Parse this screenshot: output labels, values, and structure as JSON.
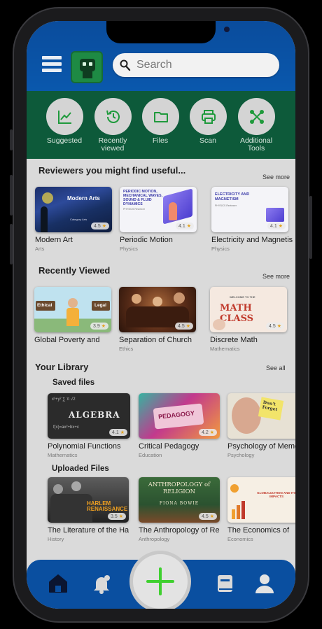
{
  "search": {
    "placeholder": "Search"
  },
  "tools": [
    {
      "label": "Suggested",
      "icon": "chart-icon"
    },
    {
      "label": "Recently viewed",
      "icon": "history-icon"
    },
    {
      "label": "Files",
      "icon": "folder-icon"
    },
    {
      "label": "Scan",
      "icon": "printer-icon"
    },
    {
      "label": "Additional Tools",
      "icon": "nodes-icon"
    }
  ],
  "reviewers": {
    "title": "Reviewers you might find useful...",
    "more": "See more",
    "cards": [
      {
        "name": "Modern Art",
        "category": "Arts",
        "rating": "4.5",
        "thumb_title": "Modern Arts",
        "thumb_sub": "Category Arts"
      },
      {
        "name": "Periodic Motion",
        "category": "Physics",
        "rating": "4.1",
        "thumb_title": "PERIODIC MOTION, MECHANICAL WAVES, SOUND & FLUID DYNAMICS",
        "thumb_sub": "PHYSICS Reviewer"
      },
      {
        "name": "Electricity and Magnetism",
        "category": "Physics",
        "rating": "4.1",
        "thumb_title": "ELECTRICITY AND MAGNETISM",
        "thumb_sub": "PHYSICS Reviewer"
      }
    ]
  },
  "recent": {
    "title": "Recently Viewed",
    "more": "See more",
    "cards": [
      {
        "name": "Global Poverty and",
        "category": "",
        "rating": "3.9",
        "sign_left": "Ethical",
        "sign_right": "Legal"
      },
      {
        "name": "Separation of Church",
        "category": "Ethics",
        "rating": "4.5"
      },
      {
        "name": "Discrete Math",
        "category": "Mathematics",
        "rating": "4.5",
        "thumb_top": "WELCOME TO THE",
        "thumb_title": "MATH CLASS"
      }
    ]
  },
  "library": {
    "title": "Your Library",
    "more": "See all",
    "saved": {
      "title": "Saved files",
      "cards": [
        {
          "name": "Polynomial Functions",
          "category": "Mathematics",
          "rating": "4.1",
          "thumb_title": "ALGEBRA"
        },
        {
          "name": "Critical Pedagogy",
          "category": "Education",
          "rating": "4.2",
          "thumb_title": "PEDAGOGY"
        },
        {
          "name": "Psychology of Memory",
          "category": "Psychology",
          "rating": "",
          "thumb_title": "Don't Forget"
        }
      ]
    },
    "uploaded": {
      "title": "Uploaded Files",
      "cards": [
        {
          "name": "The Literature of the Harlem",
          "category": "History",
          "rating": "3.5",
          "thumb_title": "HARLEM RENAISSANCE"
        },
        {
          "name": "The Anthropology of Religion",
          "category": "Anthropology",
          "rating": "4.5",
          "thumb_title": "ANTHROPOLOGY of RELIGION",
          "thumb_sub": "FIONA BOWIE"
        },
        {
          "name": "The Economics of",
          "category": "Economics",
          "rating": "",
          "thumb_title": "GLOBALIZATION AND ITS IMPACTS"
        }
      ]
    }
  },
  "nav": [
    {
      "name": "home",
      "icon": "home-icon",
      "active": true
    },
    {
      "name": "notifications",
      "icon": "bell-icon"
    },
    {
      "name": "add",
      "icon": "plus-icon"
    },
    {
      "name": "library",
      "icon": "book-icon"
    },
    {
      "name": "profile",
      "icon": "person-icon"
    }
  ],
  "colors": {
    "topbar": "#0a58ad",
    "toolbar": "#0d5a3a",
    "tool_icon": "#1f9a3c",
    "fab_plus": "#3fd02f",
    "navbar": "#0a4fa0"
  }
}
